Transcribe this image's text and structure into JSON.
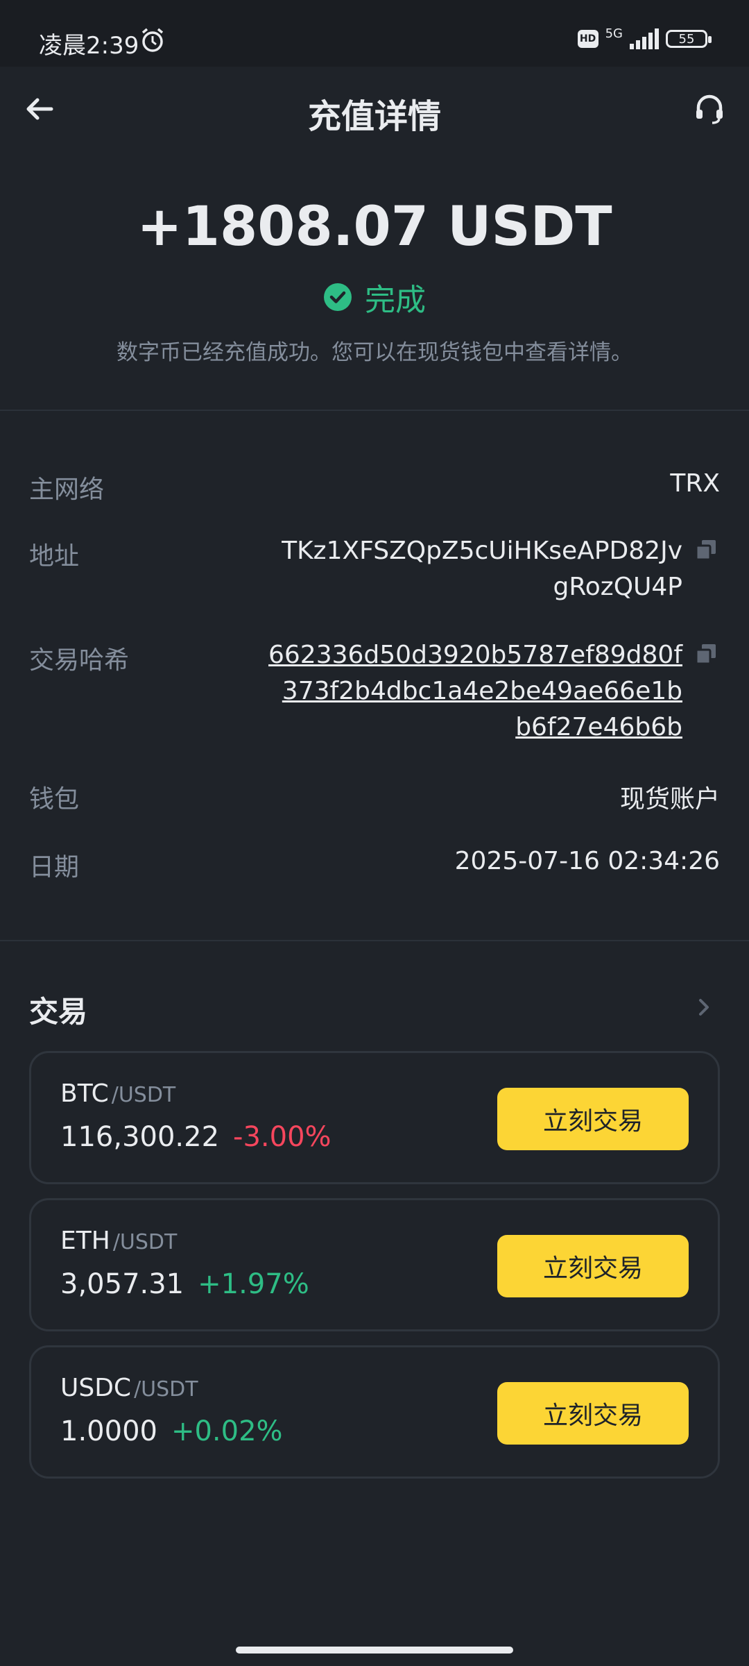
{
  "status_bar": {
    "time": "凌晨2:39",
    "hd": "HD",
    "network": "5G",
    "battery": "55"
  },
  "header": {
    "title": "充值详情"
  },
  "summary": {
    "amount": "+1808.07 USDT",
    "status": "完成",
    "description": "数字币已经充值成功。您可以在现货钱包中查看详情。"
  },
  "details": {
    "network_label": "主网络",
    "network_value": "TRX",
    "address_label": "地址",
    "address_value": "TKz1XFSZQpZ5cUiHKseAPD82JvgRozQU4P",
    "hash_label": "交易哈希",
    "hash_value": "662336d50d3920b5787ef89d80f373f2b4dbc1a4e2be49ae66e1bb6f27e46b6b",
    "wallet_label": "钱包",
    "wallet_value": "现货账户",
    "date_label": "日期",
    "date_value": "2025-07-16 02:34:26"
  },
  "trade": {
    "title": "交易",
    "items": [
      {
        "base": "BTC",
        "quote": "/USDT",
        "price": "116,300.22",
        "change": "-3.00%",
        "button": "立刻交易"
      },
      {
        "base": "ETH",
        "quote": "/USDT",
        "price": "3,057.31",
        "change": "+1.97%",
        "button": "立刻交易"
      },
      {
        "base": "USDC",
        "quote": "/USDT",
        "price": "1.0000",
        "change": "+0.02%",
        "button": "立刻交易"
      }
    ]
  },
  "colors": {
    "background": "#1f2329",
    "positive": "#2ebd85",
    "negative": "#f6465d",
    "accent": "#fcd535"
  }
}
